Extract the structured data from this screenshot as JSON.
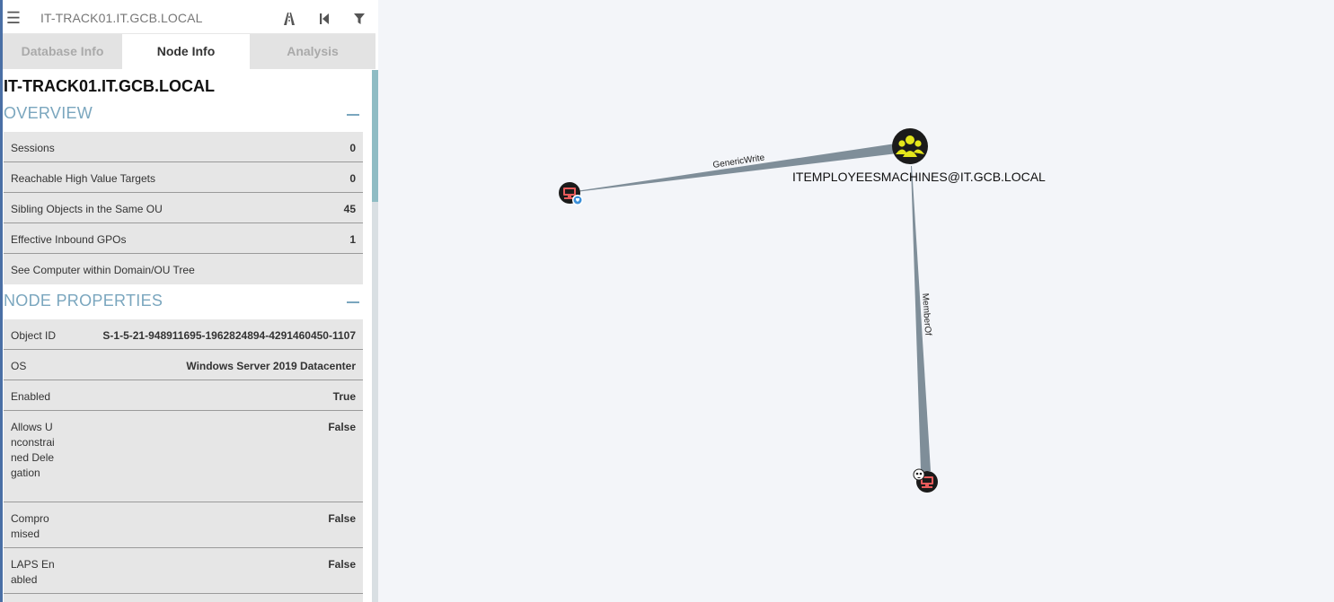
{
  "app": {
    "search_text": "IT-TRACK01.IT.GCB.LOCAL",
    "icons": [
      "menu-icon",
      "pathfinding-icon",
      "back-icon",
      "filter-icon"
    ]
  },
  "tabs": [
    {
      "label": "Database Info",
      "active": false
    },
    {
      "label": "Node Info",
      "active": true
    },
    {
      "label": "Analysis",
      "active": false
    }
  ],
  "node_info": {
    "title": "IT-TRACK01.IT.GCB.LOCAL",
    "overview": {
      "heading": "OVERVIEW",
      "rows": [
        {
          "label": "Sessions",
          "value": "0"
        },
        {
          "label": "Reachable High Value Targets",
          "value": "0"
        },
        {
          "label": "Sibling Objects in the Same OU",
          "value": "45"
        },
        {
          "label": "Effective Inbound GPOs",
          "value": "1"
        },
        {
          "label": "See Computer within Domain/OU Tree",
          "value": ""
        }
      ]
    },
    "properties": {
      "heading": "NODE PROPERTIES",
      "rows": [
        {
          "label": "Object ID",
          "value": "S-1-5-21-948911695-1962824894-4291460450-1107"
        },
        {
          "label": "OS",
          "value": "Windows Server 2019 Datacenter"
        },
        {
          "label": "Enabled",
          "value": "True"
        },
        {
          "label": "Allows Unconstrained Delegation",
          "value": "False"
        },
        {
          "label": "Compromised",
          "value": "False"
        },
        {
          "label": "LAPS Enabled",
          "value": "False"
        }
      ]
    }
  },
  "graph": {
    "group_label": "ITEMPLOYEESMACHINES@IT.GCB.LOCAL",
    "edges": [
      {
        "label": "GenericWrite"
      },
      {
        "label": "MemberOf"
      }
    ],
    "colors": {
      "edge": "#7f8e99",
      "group_fill": "#e4e61b",
      "computer_fill": "#e85c5c",
      "node_ring": "#1b1b1b"
    }
  }
}
